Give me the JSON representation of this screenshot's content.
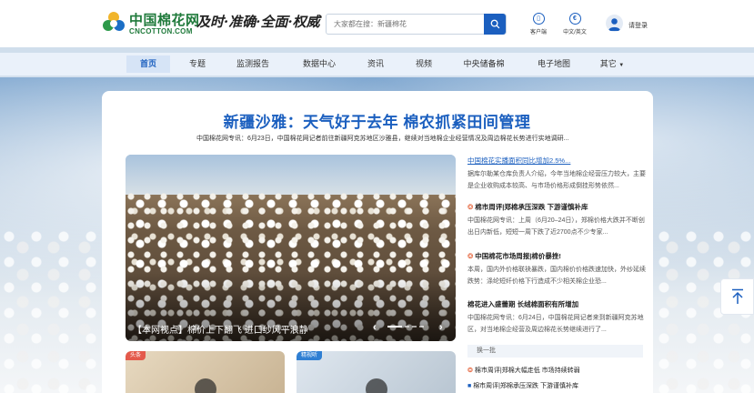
{
  "header": {
    "logo_cn": "中国棉花网",
    "logo_en": "CNCOTTON.COM",
    "slogan": "及时·准确·全面·权威",
    "search_placeholder": "大家都在搜：新疆棉花",
    "client_label": "客户端",
    "language_label": "中文/英文",
    "login_label": "请登录",
    "accent_color": "#1b5fbf"
  },
  "nav": {
    "items": [
      "首页",
      "专题",
      "监测报告",
      "数据中心",
      "资讯",
      "视频",
      "中央储备棉",
      "电子地图",
      "其它"
    ]
  },
  "headline": {
    "title": "新疆沙雅：天气好于去年 棉农抓紧田间管理",
    "summary": "中国棉花网专讯：6月23日，中国棉花网记者前往新疆阿克苏地区沙雅县，继续对当地棉企业经营情况及周边棉花长势进行实地调研..."
  },
  "hero": {
    "caption": "【本网视点】棉价上下翻飞 进口纱风平浪静",
    "prev_icon": "‹",
    "next_icon": "›"
  },
  "news": [
    {
      "title": "中国棉花实播面积同比增加2.5%...",
      "body": "据库尔勒某仓库负责人介绍，今年当地棉企经营压力较大，主要是企业收购成本较高、与市场价格形成倒挂形势依然..."
    },
    {
      "title": "棉市周评|郑棉承压深跌 下游谨慎补库",
      "body": "中国棉花网专讯：上周（6月20–24日），郑棉价格大跌并不断创出日内新低，短短一周下跌了近2700点不少专家..."
    },
    {
      "title": "中国棉花市场周报|棉价暴挫!",
      "body": "本周，国内外价格联袂暴跌，国内棉价价格跌速加快，外纱延续跌势：涤纶短纤价格下行造成不少相关棉企业恐..."
    },
    {
      "title": "棉花进入盛蕾期 长绒棉面积有所增加",
      "body": "中国棉花网专讯：6月24日，中国棉花网记者来到新疆阿克苏地区，对当地棉企经营及周边棉花长势继续进行了..."
    }
  ],
  "more": {
    "change_label": "换一批",
    "ticker_1": "棉市周评|郑棉大幅走低 市场持续转弱",
    "ticker_2": "棉市周评|郑棉承压深跌 下游谨慎补库"
  },
  "thumbs": [
    {
      "tag": "头条",
      "tag_color": "#e45a4b"
    },
    {
      "tag": "精视听",
      "tag_color": "#2f7fd3"
    }
  ]
}
